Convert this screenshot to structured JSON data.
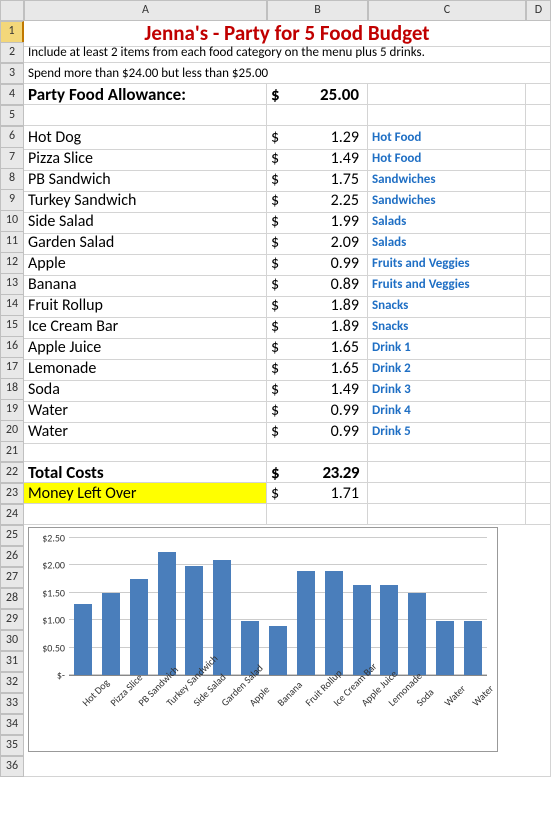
{
  "columns": [
    "A",
    "B",
    "C",
    "D"
  ],
  "rows": 36,
  "title": "Jenna's  - Party for 5 Food Budget",
  "instruction1": "Include at least 2 items from each food category on the menu plus 5 drinks.",
  "instruction2": "Spend more than $24.00 but less than $25.00",
  "allowance_label": "Party Food Allowance:",
  "allowance_sym": "$",
  "allowance_val": "25.00",
  "items": [
    {
      "name": "Hot Dog",
      "sym": "$",
      "val": "1.29",
      "cat": "Hot Food"
    },
    {
      "name": "Pizza Slice",
      "sym": "$",
      "val": "1.49",
      "cat": "Hot Food"
    },
    {
      "name": "PB Sandwich",
      "sym": "$",
      "val": "1.75",
      "cat": "Sandwiches"
    },
    {
      "name": "Turkey Sandwich",
      "sym": "$",
      "val": "2.25",
      "cat": "Sandwiches"
    },
    {
      "name": "Side Salad",
      "sym": "$",
      "val": "1.99",
      "cat": "Salads"
    },
    {
      "name": "Garden Salad",
      "sym": "$",
      "val": "2.09",
      "cat": "Salads"
    },
    {
      "name": "Apple",
      "sym": "$",
      "val": "0.99",
      "cat": "Fruits and Veggies"
    },
    {
      "name": "Banana",
      "sym": "$",
      "val": "0.89",
      "cat": "Fruits and Veggies"
    },
    {
      "name": "Fruit Rollup",
      "sym": "$",
      "val": "1.89",
      "cat": "Snacks"
    },
    {
      "name": "Ice Cream Bar",
      "sym": "$",
      "val": "1.89",
      "cat": "Snacks"
    },
    {
      "name": "Apple Juice",
      "sym": "$",
      "val": "1.65",
      "cat": "Drink 1"
    },
    {
      "name": "Lemonade",
      "sym": "$",
      "val": "1.65",
      "cat": "Drink 2"
    },
    {
      "name": "Soda",
      "sym": "$",
      "val": "1.49",
      "cat": "Drink 3"
    },
    {
      "name": "Water",
      "sym": "$",
      "val": "0.99",
      "cat": "Drink 4"
    },
    {
      "name": "Water",
      "sym": "$",
      "val": "0.99",
      "cat": "Drink 5"
    }
  ],
  "total_label": "Total Costs",
  "total_sym": "$",
  "total_val": "23.29",
  "leftover_label": "Money Left Over",
  "leftover_sym": "$",
  "leftover_val": "1.71",
  "chart_data": {
    "type": "bar",
    "categories": [
      "Hot Dog",
      "Pizza Slice",
      "PB Sandwich",
      "Turkey Sandwich",
      "Side Salad",
      "Garden Salad",
      "Apple",
      "Banana",
      "Fruit Rollup",
      "Ice Cream Bar",
      "Apple Juice",
      "Lemonade",
      "Soda",
      "Water",
      "Water"
    ],
    "values": [
      1.29,
      1.49,
      1.75,
      2.25,
      1.99,
      2.09,
      0.99,
      0.89,
      1.89,
      1.89,
      1.65,
      1.65,
      1.49,
      0.99,
      0.99
    ],
    "ylim": [
      0,
      2.5
    ],
    "yticks": [
      0,
      0.5,
      1.0,
      1.5,
      2.0,
      2.5
    ],
    "ytick_labels": [
      "$-",
      "$0.50",
      "$1.00",
      "$1.50",
      "$2.00",
      "$2.50"
    ]
  }
}
